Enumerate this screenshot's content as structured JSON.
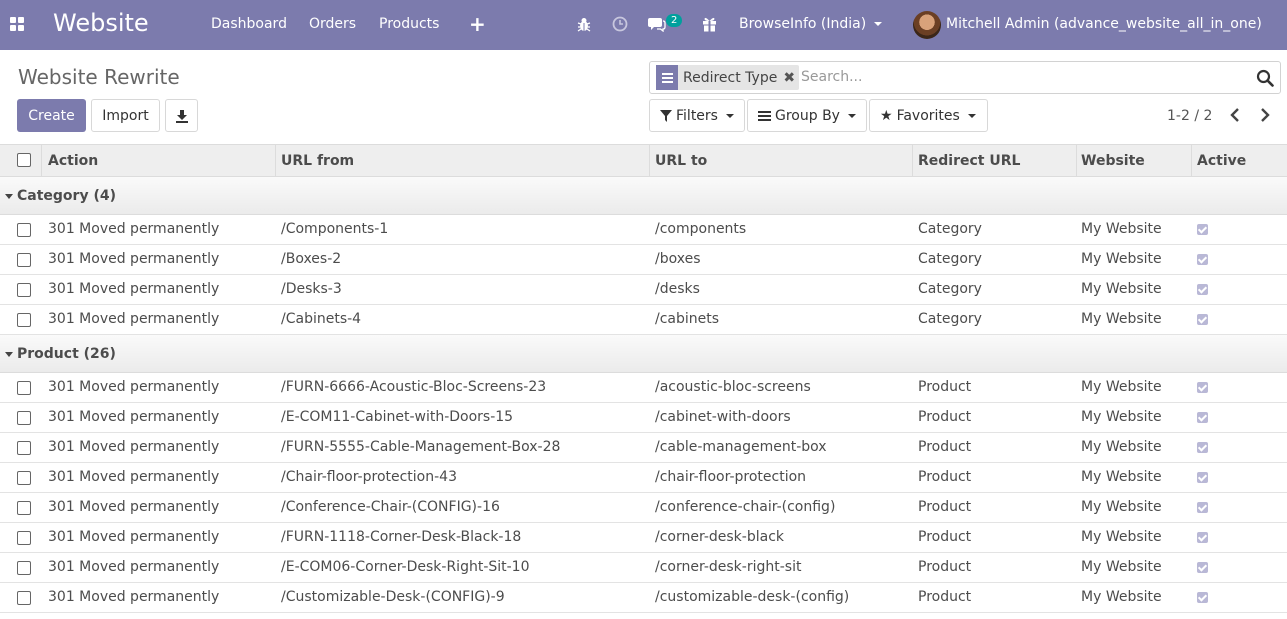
{
  "navbar": {
    "brand": "Website",
    "menu": [
      "Dashboard",
      "Orders",
      "Products"
    ],
    "chat_count": "2",
    "company": "BrowseInfo (India)",
    "user": "Mitchell Admin (advance_website_all_in_one)",
    "bg": "#7c7bad"
  },
  "page": {
    "title": "Website Rewrite",
    "create": "Create",
    "import": "Import"
  },
  "search": {
    "facet": "Redirect Type",
    "placeholder": "Search..."
  },
  "filters": {
    "filters": "Filters",
    "group_by": "Group By",
    "favorites": "Favorites"
  },
  "pager": "1-2 / 2",
  "table": {
    "columns": [
      "Action",
      "URL from",
      "URL to",
      "Redirect URL",
      "Website",
      "Active"
    ],
    "groups": [
      {
        "label": "Category (4)",
        "rows": [
          [
            "301 Moved permanently",
            "/Components-1",
            "/components",
            "Category",
            "My Website"
          ],
          [
            "301 Moved permanently",
            "/Boxes-2",
            "/boxes",
            "Category",
            "My Website"
          ],
          [
            "301 Moved permanently",
            "/Desks-3",
            "/desks",
            "Category",
            "My Website"
          ],
          [
            "301 Moved permanently",
            "/Cabinets-4",
            "/cabinets",
            "Category",
            "My Website"
          ]
        ]
      },
      {
        "label": "Product (26)",
        "rows": [
          [
            "301 Moved permanently",
            "/FURN-6666-Acoustic-Bloc-Screens-23",
            "/acoustic-bloc-screens",
            "Product",
            "My Website"
          ],
          [
            "301 Moved permanently",
            "/E-COM11-Cabinet-with-Doors-15",
            "/cabinet-with-doors",
            "Product",
            "My Website"
          ],
          [
            "301 Moved permanently",
            "/FURN-5555-Cable-Management-Box-28",
            "/cable-management-box",
            "Product",
            "My Website"
          ],
          [
            "301 Moved permanently",
            "/Chair-floor-protection-43",
            "/chair-floor-protection",
            "Product",
            "My Website"
          ],
          [
            "301 Moved permanently",
            "/Conference-Chair-(CONFIG)-16",
            "/conference-chair-(config)",
            "Product",
            "My Website"
          ],
          [
            "301 Moved permanently",
            "/FURN-1118-Corner-Desk-Black-18",
            "/corner-desk-black",
            "Product",
            "My Website"
          ],
          [
            "301 Moved permanently",
            "/E-COM06-Corner-Desk-Right-Sit-10",
            "/corner-desk-right-sit",
            "Product",
            "My Website"
          ],
          [
            "301 Moved permanently",
            "/Customizable-Desk-(CONFIG)-9",
            "/customizable-desk-(config)",
            "Product",
            "My Website"
          ]
        ]
      }
    ]
  }
}
